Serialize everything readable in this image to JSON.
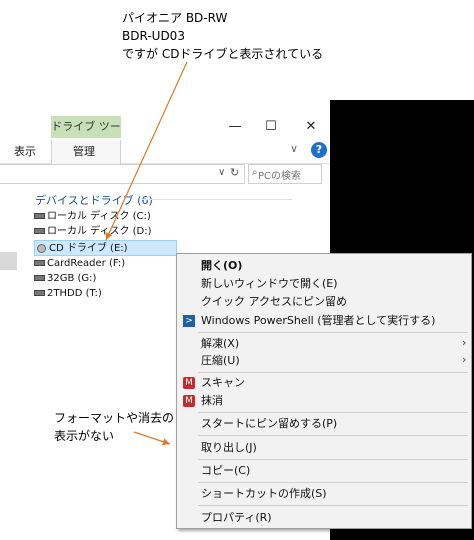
{
  "annotations": {
    "top": [
      "パイオニア BD-RW",
      "BDR-UD03",
      "ですが CDドライブと表示されている"
    ],
    "bottom": [
      "フォーマットや消去の",
      "表示がない"
    ]
  },
  "window": {
    "drive_tools_label": "ドライブ ツール",
    "minimize": "—",
    "maximize": "☐",
    "close": "✕"
  },
  "ribbon": {
    "tabs": [
      "表示",
      "管理"
    ],
    "collapse": "∨",
    "help": "?"
  },
  "address": {
    "chevron": "∨",
    "refresh": "↻",
    "search_placeholder": "PCの検索"
  },
  "group": {
    "header": "デバイスとドライブ (6)"
  },
  "drives": [
    "ローカル ディスク (C:)",
    "ローカル ディスク (D:)",
    "CD ドライブ (E:)",
    "CardReader (F:)",
    "32GB (G:)",
    "2THDD (T:)"
  ],
  "context_menu": {
    "open": "開く(O)",
    "open_new_window": "新しいウィンドウで開く(E)",
    "pin_quick_access": "クイック アクセスにピン留め",
    "powershell": "Windows PowerShell (管理者として実行する)",
    "extract": "解凍(X)",
    "compress": "圧縮(U)",
    "scan": "スキャン",
    "erase": "抹消",
    "pin_start": "スタートにピン留めする(P)",
    "eject": "取り出し(J)",
    "copy": "コピー(C)",
    "create_shortcut": "ショートカットの作成(S)",
    "properties": "プロパティ(R)",
    "submenu_arrow": "›"
  },
  "colors": {
    "arrow": "#e07a20",
    "selection": "#cde8ff",
    "drive_tools_tab": "#c8e0b8",
    "help_icon": "#1e6fc8"
  }
}
